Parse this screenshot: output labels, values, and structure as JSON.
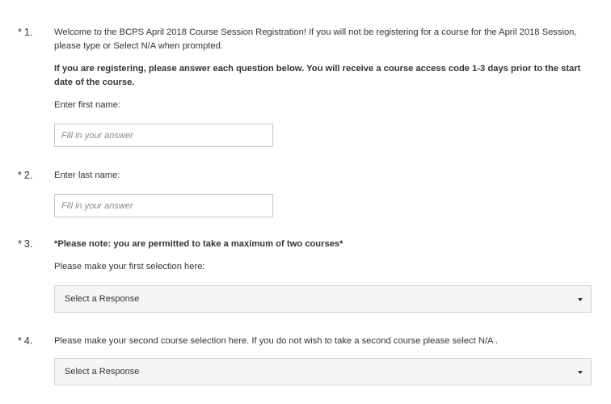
{
  "questions": [
    {
      "star": "*",
      "number": "1.",
      "intro": "Welcome to the BCPS April 2018 Course Session Registration!  If you will not be registering for a course for the April 2018 Session, please type or Select N/A when prompted.",
      "note": "If you are registering, please answer each question below. You will receive a course access code 1-3 days prior to the start date of the course.",
      "prompt": "Enter first name:",
      "placeholder": "Fill in your answer"
    },
    {
      "star": "*",
      "number": "2.",
      "prompt": "Enter last name:",
      "placeholder": "Fill in your answer"
    },
    {
      "star": "*",
      "number": "3.",
      "note": "*Please note: you are permitted to take a maximum of two courses*",
      "prompt": "Please make your first selection here:",
      "selected": "Select a Response"
    },
    {
      "star": "*",
      "number": "4.",
      "prompt": "Please make your second course selection here.  If you do not wish to take a second course please select N/A .",
      "selected": "Select a Response"
    }
  ]
}
